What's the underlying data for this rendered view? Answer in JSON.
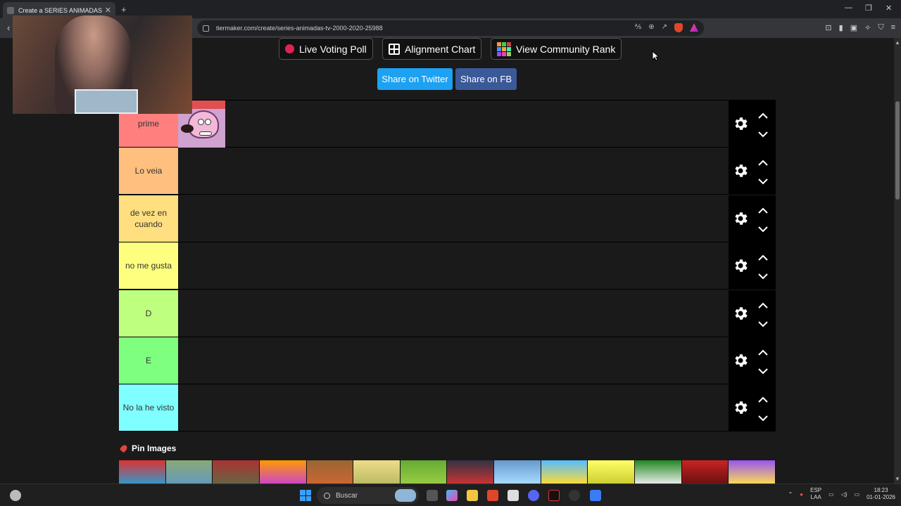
{
  "browser": {
    "tab_title": "Create a SERIES ANIMADAS TV ...",
    "tab_close": "✕",
    "new_tab": "+",
    "url": "tiermaker.com/create/series-animadas-tv-2000-2020-25988"
  },
  "header_buttons": {
    "live_voting": "Live Voting Poll",
    "alignment": "Alignment Chart",
    "community_rank": "View Community Rank"
  },
  "share": {
    "twitter": "Share on Twitter",
    "facebook": "Share on FB"
  },
  "tiers": [
    {
      "label": "prime",
      "color": "#ff7f7f"
    },
    {
      "label": "Lo veia",
      "color": "#ffbf7f"
    },
    {
      "label": "de vez en cuando",
      "color": "#ffdf7f"
    },
    {
      "label": "no me gusta",
      "color": "#ffff7f"
    },
    {
      "label": "D",
      "color": "#bfff7f"
    },
    {
      "label": "E",
      "color": "#7fff7f"
    },
    {
      "label": "No la he visto",
      "color": "#7fffff"
    }
  ],
  "pin_images": "Pin Images",
  "taskbar": {
    "search_placeholder": "Buscar",
    "lang_1": "ESP",
    "lang_2": "LAA",
    "time": "18:23",
    "date": "01-01-2026"
  }
}
